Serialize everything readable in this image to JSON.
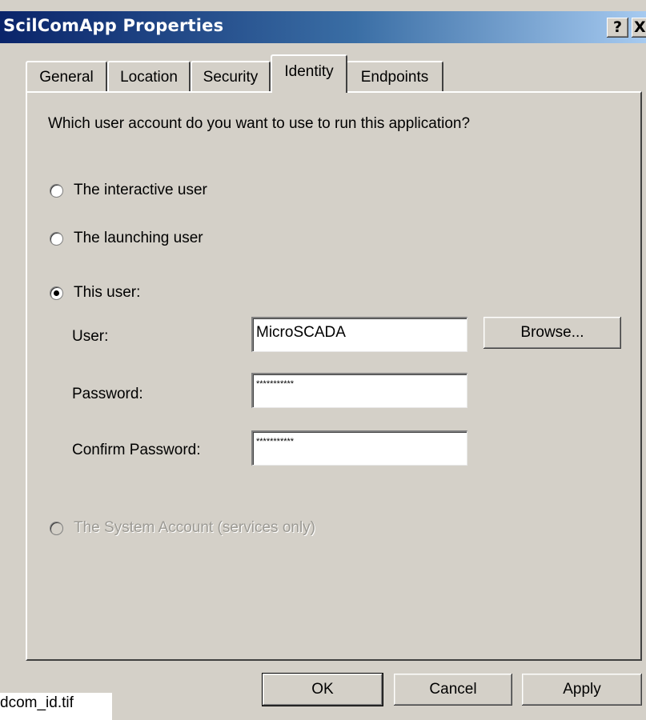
{
  "window": {
    "title": "ScilComApp Properties",
    "help_label": "?",
    "close_label": "X"
  },
  "tabs": [
    {
      "label": "General",
      "active": false
    },
    {
      "label": "Location",
      "active": false
    },
    {
      "label": "Security",
      "active": false
    },
    {
      "label": "Identity",
      "active": true
    },
    {
      "label": "Endpoints",
      "active": false
    }
  ],
  "identity": {
    "question": "Which user account do you want to use to run this application?",
    "options": [
      {
        "label": "The interactive user",
        "selected": false,
        "enabled": true
      },
      {
        "label": "The launching user",
        "selected": false,
        "enabled": true
      },
      {
        "label": "This user:",
        "selected": true,
        "enabled": true
      },
      {
        "label": "The System Account (services only)",
        "selected": false,
        "enabled": false
      }
    ],
    "user_label": "User:",
    "user_value": "MicroSCADA",
    "browse_label": "Browse...",
    "password_label": "Password:",
    "password_value": "***********",
    "confirm_label": "Confirm Password:",
    "confirm_value": "***********"
  },
  "buttons": {
    "ok": "OK",
    "cancel": "Cancel",
    "apply": "Apply"
  },
  "caption": "dcom_id.tif"
}
